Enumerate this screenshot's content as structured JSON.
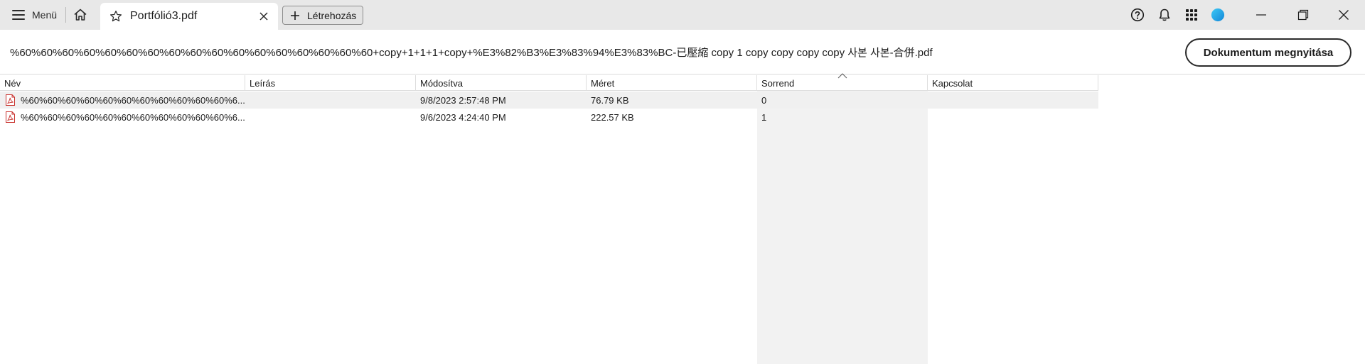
{
  "titlebar": {
    "menu_label": "Menü",
    "tab_title": "Portfólió3.pdf",
    "create_label": "Létrehozás"
  },
  "icons": {
    "menu": "hamburger-icon",
    "home": "home-icon",
    "favorite": "star-icon",
    "tab_close": "close-icon",
    "create": "plus-icon",
    "help": "help-icon",
    "notifications": "bell-icon",
    "apps": "apps-grid-icon",
    "account": "avatar",
    "file": "pdf-file-icon"
  },
  "document": {
    "name": "%60%60%60%60%60%60%60%60%60%60%60%60%60%60%60%60%60+copy+1+1+1+copy+%E3%82%B3%E3%83%94%E3%83%BC-已壓縮 copy 1 copy copy copy copy 사본 사본-合併.pdf",
    "open_button": "Dokumentum megnyitása"
  },
  "table": {
    "columns": [
      {
        "key": "name",
        "label": "Név"
      },
      {
        "key": "description",
        "label": "Leírás"
      },
      {
        "key": "modified",
        "label": "Módosítva"
      },
      {
        "key": "size",
        "label": "Méret"
      },
      {
        "key": "order",
        "label": "Sorrend"
      },
      {
        "key": "link",
        "label": "Kapcsolat"
      }
    ],
    "sorted_column": "Sorrend",
    "rows": [
      {
        "name": "%60%60%60%60%60%60%60%60%60%60%60%6...",
        "description": "",
        "modified": "9/8/2023 2:57:48 PM",
        "size": "76.79 KB",
        "order": "0",
        "link": ""
      },
      {
        "name": "%60%60%60%60%60%60%60%60%60%60%60%6...",
        "description": "",
        "modified": "9/6/2023 4:24:40 PM",
        "size": "222.57 KB",
        "order": "1",
        "link": ""
      }
    ]
  },
  "colors": {
    "titlebar_bg": "#e8e8e8",
    "selected_row_bg": "#f0f0f0",
    "sorted_column_bg": "#f2f2f2",
    "pdf_red": "#c8302c",
    "avatar_blue": "#1aa7e6"
  }
}
